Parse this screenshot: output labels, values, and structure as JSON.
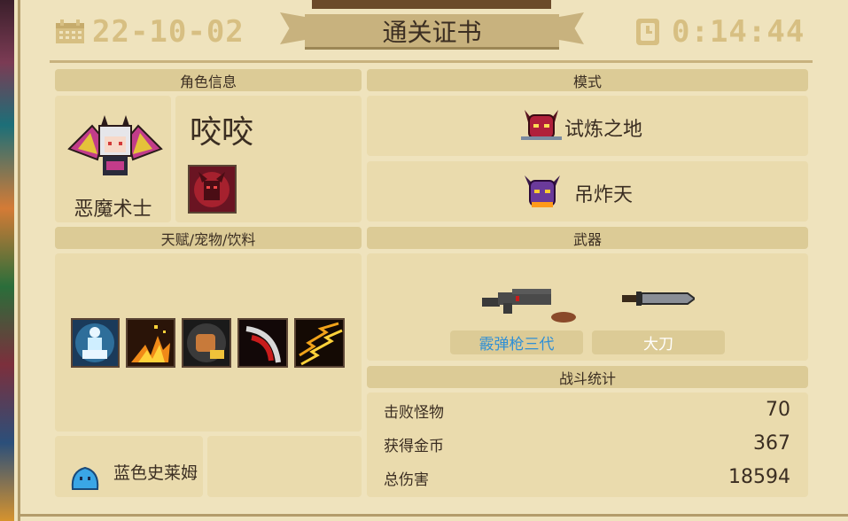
{
  "header": {
    "date": "22-10-02",
    "title": "通关证书",
    "time": "0:14:44"
  },
  "character": {
    "section_label": "角色信息",
    "class_name": "恶魔术士",
    "player_name": "咬咬"
  },
  "mode": {
    "section_label": "模式",
    "items": [
      {
        "label": "试炼之地",
        "icon": "demon-helmet-icon"
      },
      {
        "label": "吊炸天",
        "icon": "purple-demon-icon"
      }
    ]
  },
  "talents": {
    "section_label": "天赋/宠物/饮料",
    "icons": [
      "glowing-statue-icon",
      "fire-burst-icon",
      "fist-punch-icon",
      "scythe-slash-icon",
      "lightning-floor-icon"
    ],
    "pet_name": "蓝色史莱姆"
  },
  "weapons": {
    "section_label": "武器",
    "items": [
      {
        "label": "霰弹枪三代",
        "color": "#2f8fd6",
        "icon": "shotgun-icon"
      },
      {
        "label": "大刀",
        "color": "#ffffff",
        "icon": "great-blade-icon"
      }
    ]
  },
  "battle_stats": {
    "section_label": "战斗统计",
    "rows": [
      {
        "label": "击败怪物",
        "value": "70"
      },
      {
        "label": "获得金币",
        "value": "367"
      },
      {
        "label": "总伤害",
        "value": "18594"
      }
    ]
  }
}
